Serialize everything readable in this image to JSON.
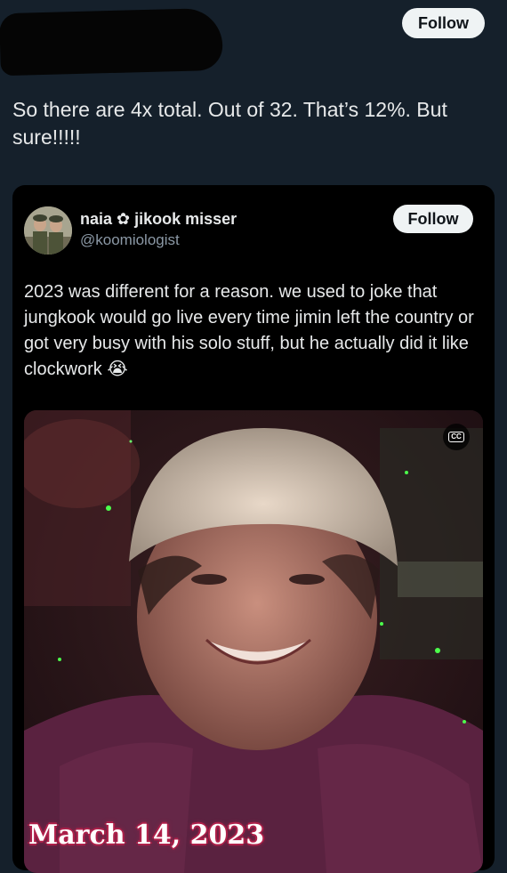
{
  "top": {
    "follow_label": "Follow"
  },
  "post": {
    "text": "So there are 4x total. Out of 32. That’s 12%. But sure!!!!!"
  },
  "quoted": {
    "name": "naia ✿ jikook misser",
    "handle": "@koomiologist",
    "follow_label": "Follow",
    "text": "2023 was different for a reason. we used to joke that jungkook would go live every time jimin left the country or got very busy with his solo stuff, but he actually did it like clockwork 😭",
    "media": {
      "caption": "March 14, 2023",
      "cc_label": "CC"
    }
  },
  "colors": {
    "background": "#15202b",
    "quote_background": "#000000",
    "button": "#eff3f4",
    "handle": "#8b98a5"
  }
}
